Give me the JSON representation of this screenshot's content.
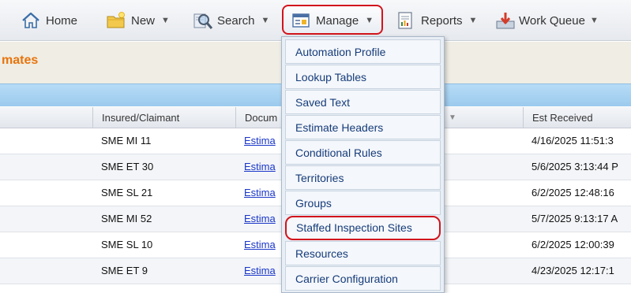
{
  "toolbar": {
    "items": [
      {
        "label": "Home",
        "icon": "home-icon",
        "has_menu": false
      },
      {
        "label": "New",
        "icon": "new-folder-icon",
        "has_menu": true
      },
      {
        "label": "Search",
        "icon": "search-icon",
        "has_menu": true
      },
      {
        "label": "Manage",
        "icon": "manage-icon",
        "has_menu": true
      },
      {
        "label": "Reports",
        "icon": "reports-icon",
        "has_menu": true
      },
      {
        "label": "Work Queue",
        "icon": "work-queue-icon",
        "has_menu": true
      }
    ],
    "caret": "▼"
  },
  "page": {
    "title": "mates"
  },
  "table": {
    "headers": [
      "",
      "Insured/Claimant",
      "Docum",
      "",
      "Est Received"
    ],
    "rows": [
      {
        "insured": "SME MI 11",
        "document": "Estima",
        "received": "4/16/2025 11:51:3"
      },
      {
        "insured": "SME ET 30",
        "document": "Estima",
        "received": "5/6/2025 3:13:44 P"
      },
      {
        "insured": "SME SL 21",
        "document": "Estima",
        "received": "6/2/2025 12:48:16"
      },
      {
        "insured": "SME MI 52",
        "document": "Estima",
        "received": "5/7/2025 9:13:17 A"
      },
      {
        "insured": "SME SL 10",
        "document": "Estima",
        "received": "6/2/2025 12:00:39"
      },
      {
        "insured": "SME ET 9",
        "document": "Estima",
        "received": "4/23/2025 12:17:1"
      }
    ]
  },
  "manage_menu": {
    "items": [
      "Automation Profile",
      "Lookup Tables",
      "Saved Text",
      "Estimate Headers",
      "Conditional Rules",
      "Territories",
      "Groups",
      "Staffed Inspection Sites",
      "Resources",
      "Carrier Configuration"
    ],
    "highlighted_index": 7
  },
  "colors": {
    "title": "#e8740c",
    "highlight_border": "#d2141c",
    "link": "#1a36c8",
    "menu_text": "#163c7a"
  }
}
